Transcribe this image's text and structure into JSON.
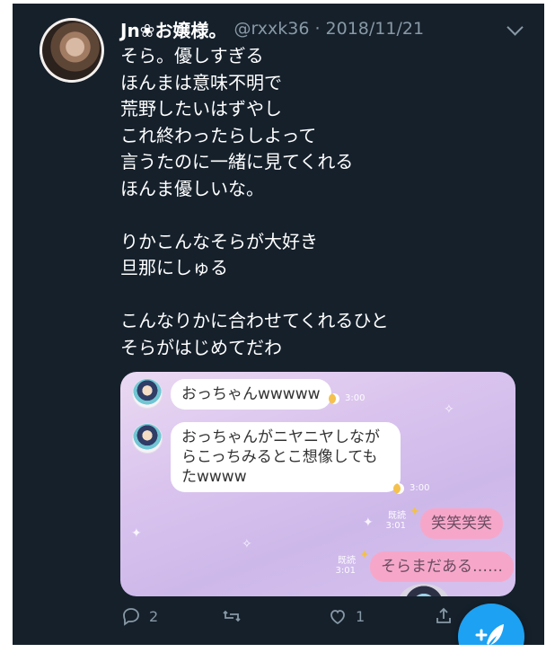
{
  "tweet": {
    "display_name": "Jn❀お嬢様。",
    "handle_and_date": "@rxxk36 · 2018/11/21",
    "lines": [
      "そら。優しすぎる",
      "ほんまは意味不明で",
      "荒野したいはずやし",
      "これ終わったらしよって",
      "言うたのに一緒に見てくれる",
      "ほんま優しいな。",
      "",
      "りかこんなそらが大好き",
      "旦那にしゅる",
      "",
      "こんなりかに合わせてくれるひと",
      "そらがはじめてだわ"
    ]
  },
  "chat": {
    "messages": [
      {
        "text": "おっちゃんwwwww",
        "time": "3:00"
      },
      {
        "text": "おっちゃんがニヤニヤしながらこっちみるとこ想像してもたwwww",
        "time": "3:00"
      },
      {
        "text": "笑笑笑笑",
        "time": "3:01",
        "status": "既読"
      },
      {
        "text": "そらまだある……",
        "time": "3:01",
        "status": "既読"
      }
    ]
  },
  "actions": {
    "reply_count": "2",
    "retweet_count": "",
    "like_count": "1"
  },
  "colors": {
    "background": "#15202b",
    "accent": "#1da1f2",
    "secondary_text": "#8899a6"
  },
  "icons": [
    "reply-icon",
    "retweet-icon",
    "like-icon",
    "share-icon",
    "compose-icon",
    "chevron-down-icon"
  ]
}
